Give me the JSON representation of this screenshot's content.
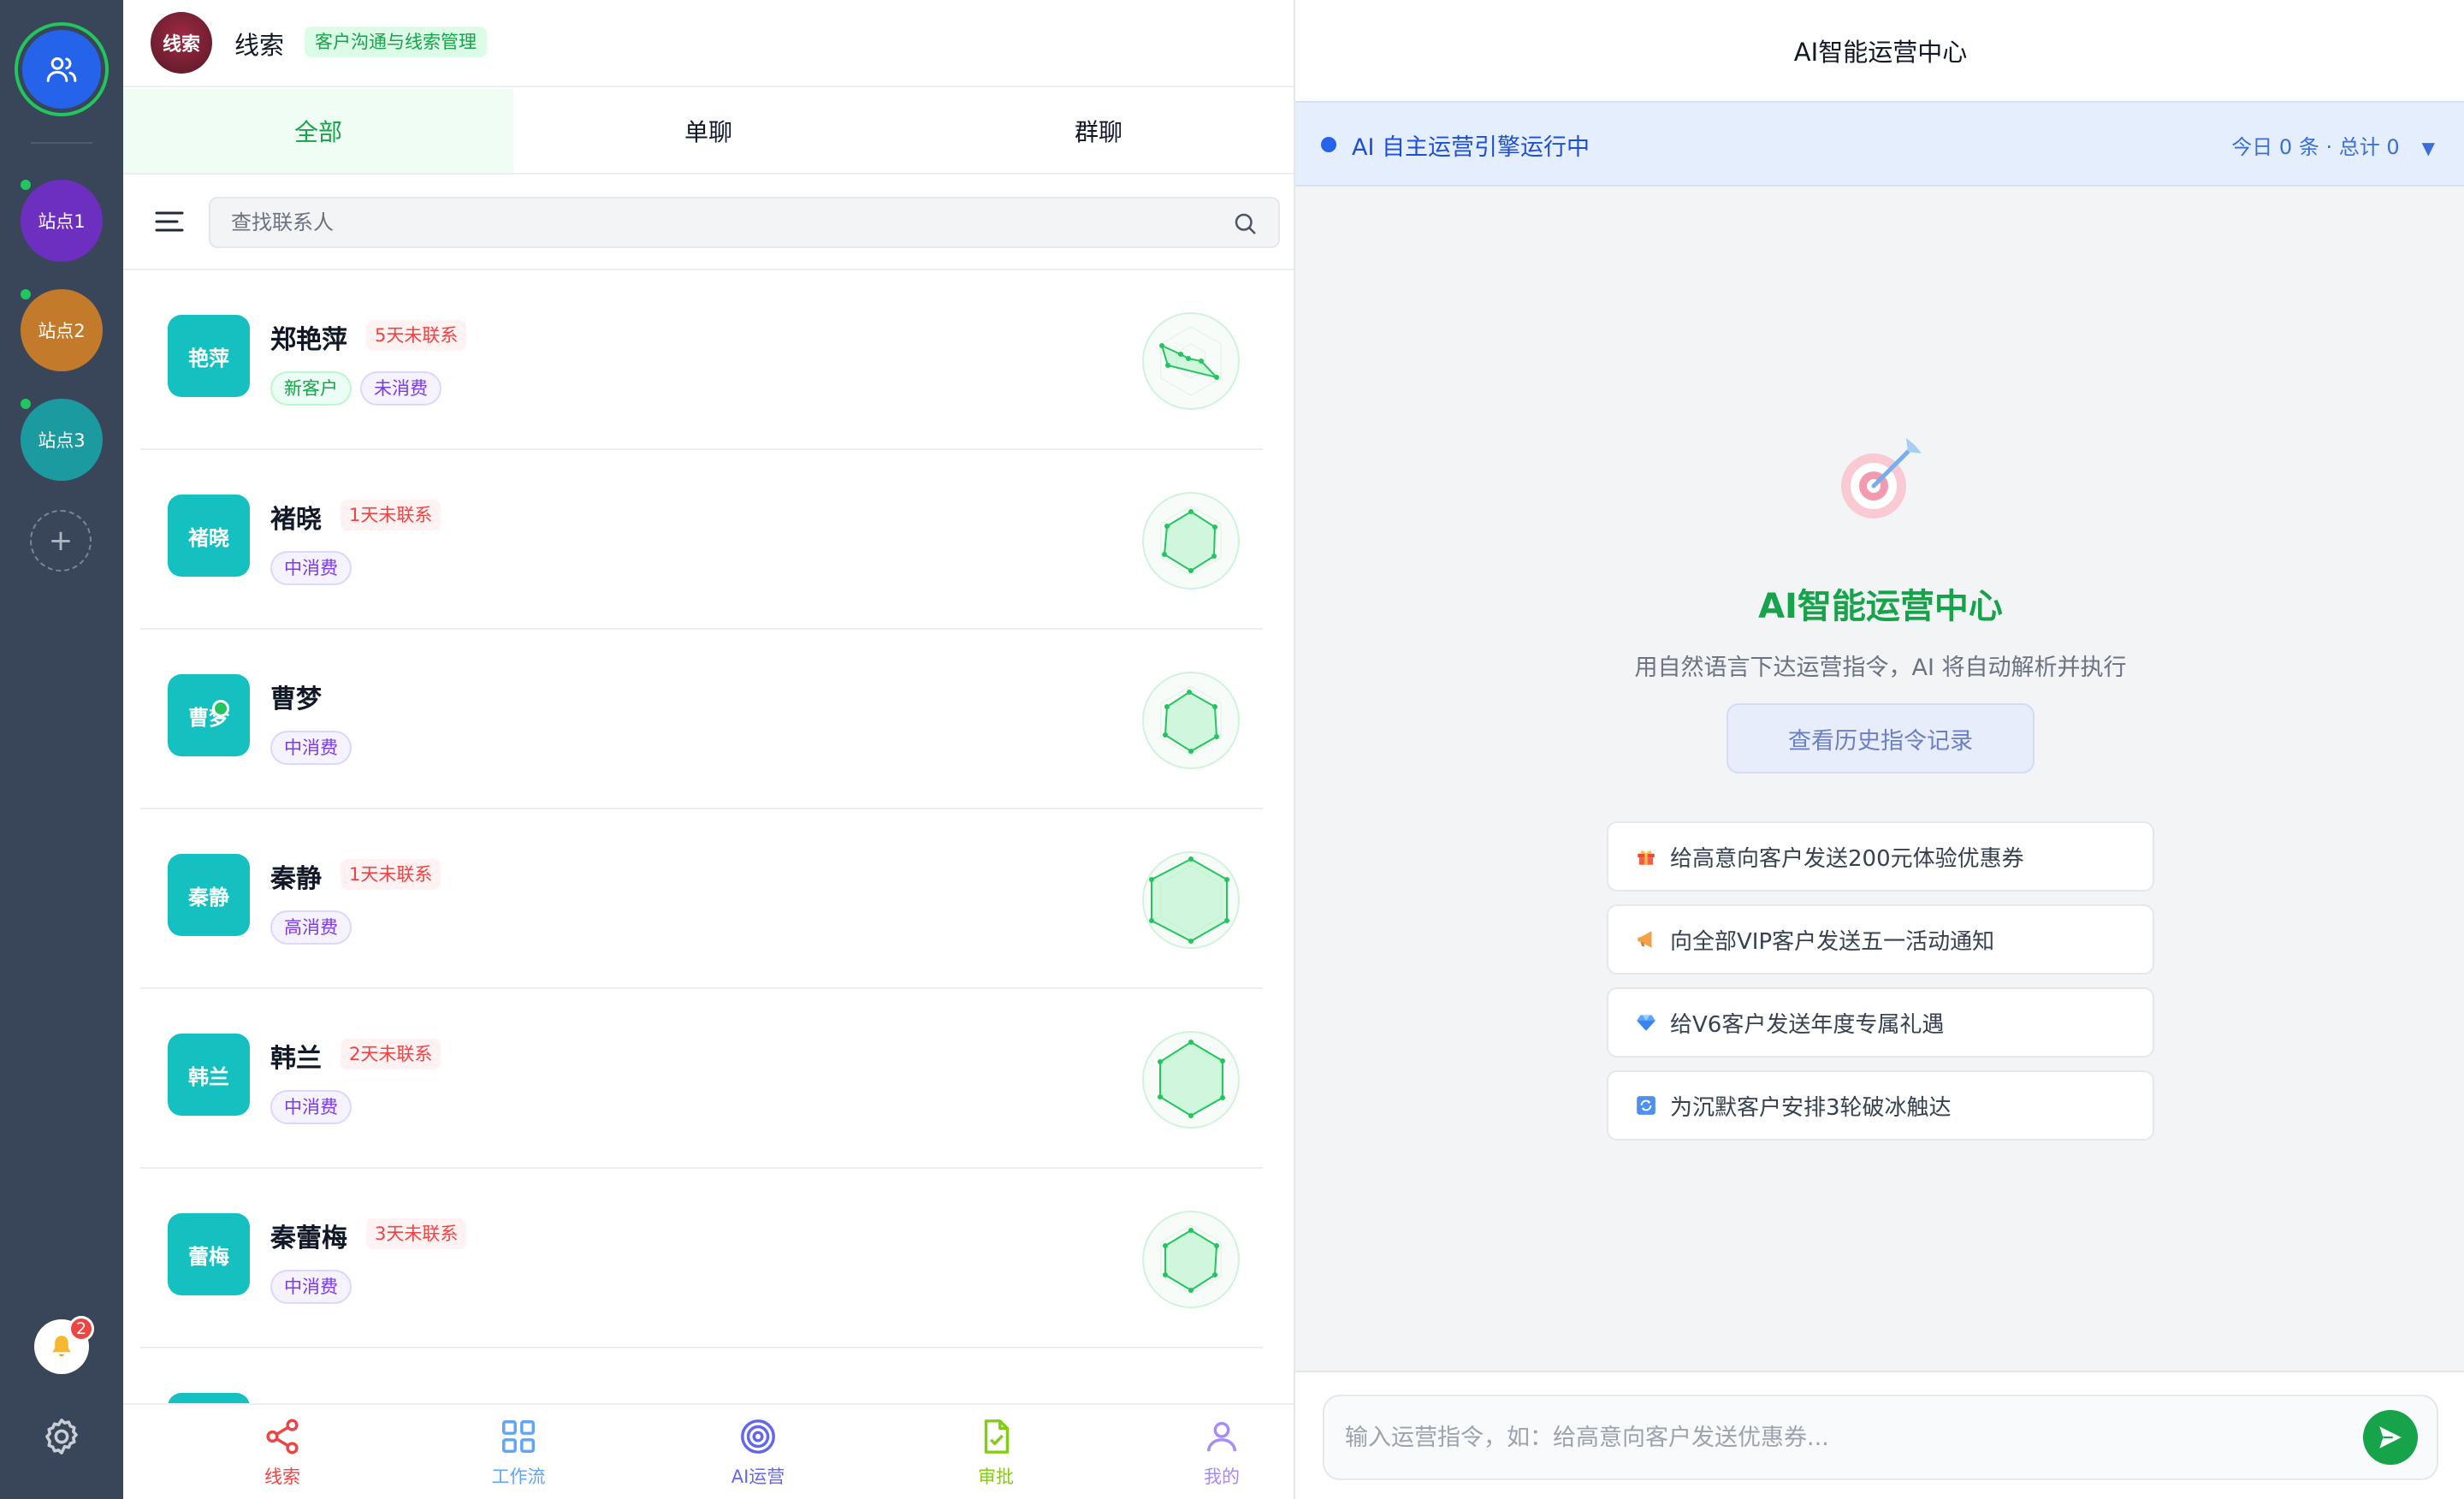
{
  "rail": {
    "sites": [
      {
        "label": "站点1",
        "color": "#6d2fbf"
      },
      {
        "label": "站点2",
        "color": "#c47a2b"
      },
      {
        "label": "站点3",
        "color": "#1b9aa0"
      }
    ],
    "add_label": "+",
    "notification_count": "2"
  },
  "mid": {
    "logo_text": "线索",
    "title": "线索",
    "subtitle": "客户沟通与线索管理",
    "tabs": [
      "全部",
      "单聊",
      "群聊"
    ],
    "search_placeholder": "查找联系人",
    "contacts": [
      {
        "avatar": "艳萍",
        "name": "郑艳萍",
        "stale": "5天未联系",
        "tags": [
          "新客户",
          "未消费"
        ],
        "online": false
      },
      {
        "avatar": "褚晓",
        "name": "褚晓",
        "stale": "1天未联系",
        "tags": [
          "中消费"
        ],
        "online": false
      },
      {
        "avatar": "曹梦",
        "name": "曹梦",
        "stale": "",
        "tags": [
          "中消费"
        ],
        "online": true
      },
      {
        "avatar": "秦静",
        "name": "秦静",
        "stale": "1天未联系",
        "tags": [
          "高消费"
        ],
        "online": false
      },
      {
        "avatar": "韩兰",
        "name": "韩兰",
        "stale": "2天未联系",
        "tags": [
          "中消费"
        ],
        "online": false
      },
      {
        "avatar": "蕾梅",
        "name": "秦蕾梅",
        "stale": "3天未联系",
        "tags": [
          "中消费"
        ],
        "online": false
      }
    ],
    "nav": [
      {
        "label": "线索",
        "color": "#ef4444"
      },
      {
        "label": "工作流",
        "color": "#60a5fa"
      },
      {
        "label": "AI运营",
        "color": "#6366f1"
      },
      {
        "label": "审批",
        "color": "#84cc16"
      },
      {
        "label": "我的",
        "color": "#a78bfa"
      }
    ]
  },
  "right": {
    "header": "AI智能运营中心",
    "status": "AI 自主运营引擎运行中",
    "counts": "今日 0 条 · 总计 0",
    "caret": "▼",
    "title": "AI智能运营中心",
    "description": "用自然语言下达运营指令，AI 将自动解析并执行",
    "history_button": "查看历史指令记录",
    "suggestions": [
      {
        "icon": "gift-icon",
        "text": "给高意向客户发送200元体验优惠券"
      },
      {
        "icon": "megaphone-icon",
        "text": "向全部VIP客户发送五一活动通知"
      },
      {
        "icon": "diamond-icon",
        "text": "给V6客户发送年度专属礼遇"
      },
      {
        "icon": "refresh-icon",
        "text": "为沉默客户安排3轮破冰触达"
      }
    ],
    "input_placeholder": "输入运营指令，如：给高意向客户发送优惠券..."
  }
}
